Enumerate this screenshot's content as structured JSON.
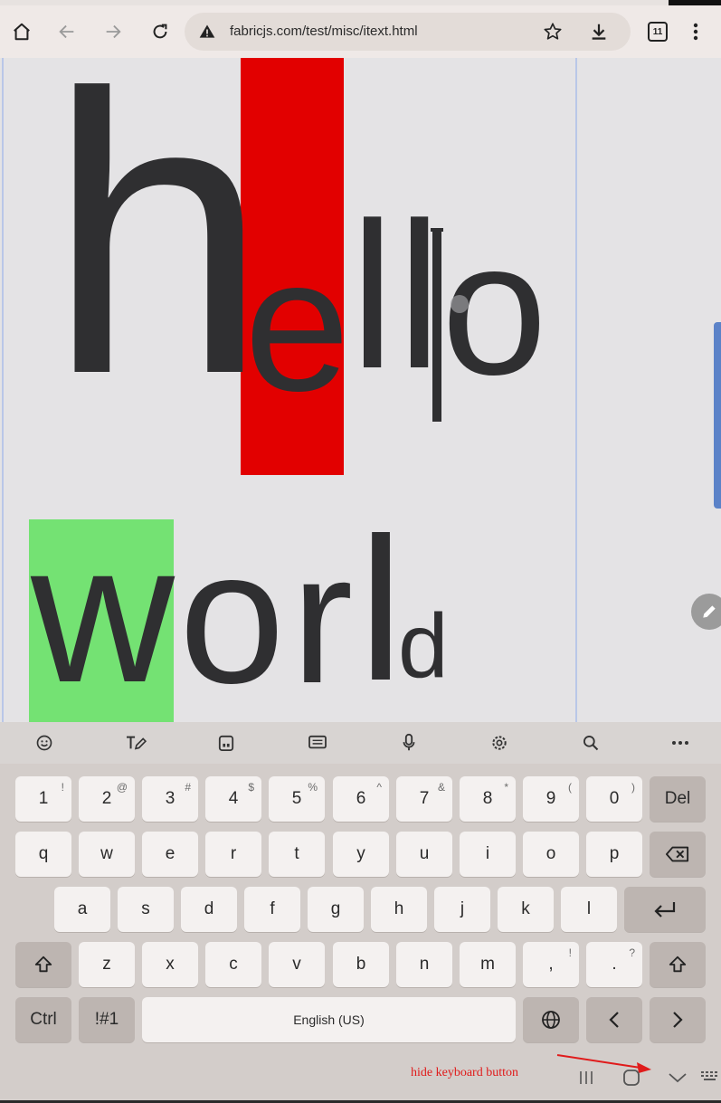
{
  "browser": {
    "url": "fabricjs.com/test/misc/itext.html",
    "tab_count": "11"
  },
  "canvas": {
    "letters": [
      "h",
      "e",
      "l",
      "l",
      "o",
      "w",
      "o",
      "r",
      "l",
      "d"
    ],
    "highlight_colors": {
      "red": "#e20000",
      "green": "#74e273"
    }
  },
  "keyboard": {
    "toolbar_icons": [
      "emoji-icon",
      "handwriting-icon",
      "clipboard-icon",
      "keyboard-mode-icon",
      "microphone-icon",
      "settings-icon",
      "search-icon",
      "more-icon"
    ],
    "row1": [
      {
        "label": "1",
        "sup": "!"
      },
      {
        "label": "2",
        "sup": "@"
      },
      {
        "label": "3",
        "sup": "#"
      },
      {
        "label": "4",
        "sup": "$"
      },
      {
        "label": "5",
        "sup": "%"
      },
      {
        "label": "6",
        "sup": "^"
      },
      {
        "label": "7",
        "sup": "&"
      },
      {
        "label": "8",
        "sup": "*"
      },
      {
        "label": "9",
        "sup": "("
      },
      {
        "label": "0",
        "sup": ")"
      }
    ],
    "del_label": "Del",
    "row2": [
      "q",
      "w",
      "e",
      "r",
      "t",
      "y",
      "u",
      "i",
      "o",
      "p"
    ],
    "row3": [
      "a",
      "s",
      "d",
      "f",
      "g",
      "h",
      "j",
      "k",
      "l"
    ],
    "row4": [
      "z",
      "x",
      "c",
      "v",
      "b",
      "n",
      "m"
    ],
    "comma_key": {
      "label": ",",
      "sup": "!"
    },
    "period_key": {
      "label": ".",
      "sup": "?"
    },
    "ctrl_label": "Ctrl",
    "symbols_label": "!#1",
    "space_label": "English (US)"
  },
  "annotation": {
    "text": "hide keyboard button",
    "color": "#e01b1b"
  }
}
